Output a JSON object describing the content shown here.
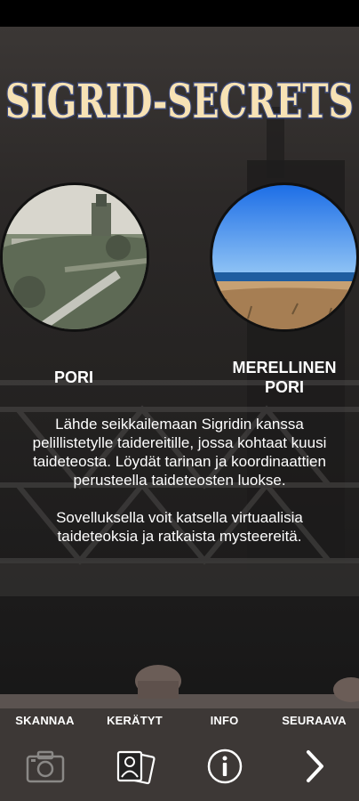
{
  "app": {
    "title": "SIGRID-SECRETS"
  },
  "locations": [
    {
      "label": "PORI"
    },
    {
      "label": "MERELLINEN\nPORI"
    }
  ],
  "description": {
    "paragraph1": "Lähde seikkailemaan Sigridin kanssa pelillistetylle taidereitille, jossa kohtaat kuusi taideteosta. Löydät tarinan ja koordinaattien perusteella taideteosten luokse.",
    "paragraph2": "Sovelluksella voit katsella virtuaalisia taideteoksia ja ratkaista mysteereitä."
  },
  "tabs": [
    {
      "label": "SKANNAA",
      "icon": "camera-icon"
    },
    {
      "label": "KERÄTYT",
      "icon": "collected-images-icon"
    },
    {
      "label": "INFO",
      "icon": "info-icon"
    },
    {
      "label": "SEURAAVA",
      "icon": "chevron-right-icon"
    }
  ],
  "colors": {
    "logo_fill": "#f7e2b5",
    "logo_outline": "#3d4a7a",
    "text": "#ffffff"
  }
}
